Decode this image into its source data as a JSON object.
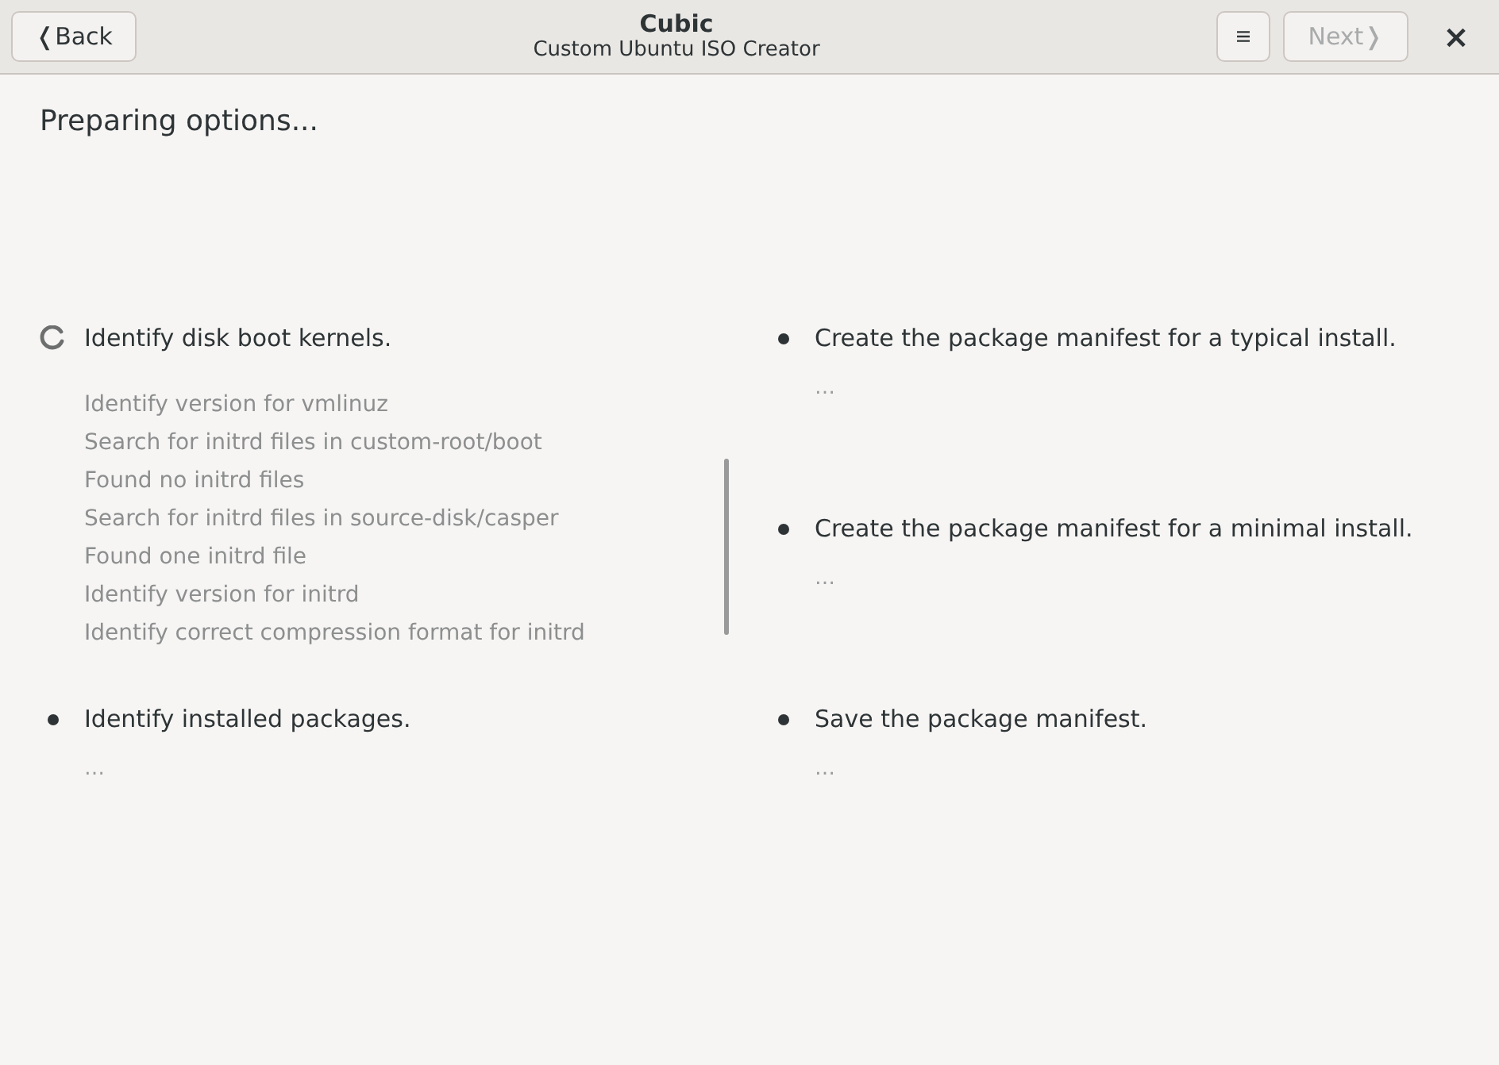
{
  "header": {
    "back_button": {
      "label": "❬Back",
      "disabled": false
    },
    "title": "Cubic",
    "subtitle": "Custom Ubuntu ISO Creator",
    "next_button": {
      "label": "Next❭",
      "disabled": true
    },
    "close_button": {
      "label": "×"
    }
  },
  "heading": "Preparing options...",
  "columns": [
    [
      {
        "kind": "running",
        "title": "Identify disk boot kernels.",
        "details": [
          "Identify version for vmlinuz",
          "Search for initrd files in custom-root/boot",
          "Found no initrd files",
          "Search for initrd files in source-disk/casper",
          "Found one initrd file",
          "Identify version for initrd",
          "Identify correct compression format for initrd"
        ]
      },
      {
        "kind": "pending",
        "title": "Identify installed packages.",
        "details": [
          "…"
        ]
      }
    ],
    [
      {
        "kind": "pending",
        "title": "Create the package manifest for a typical install.",
        "details": [
          "…"
        ]
      },
      {
        "kind": "pending",
        "title": "Create the package manifest for a minimal install.",
        "details": [
          "…"
        ]
      },
      {
        "kind": "pending",
        "title": "Save the package manifest.",
        "details": [
          "…"
        ]
      }
    ]
  ]
}
